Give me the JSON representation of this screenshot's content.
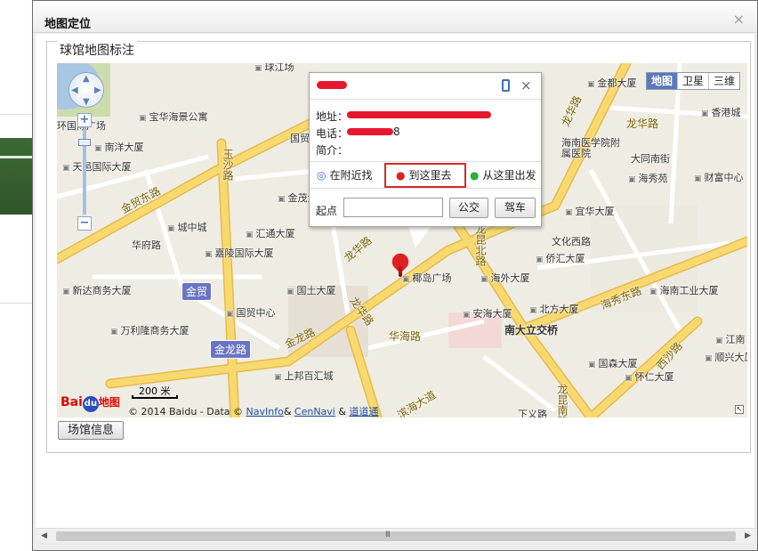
{
  "dialog": {
    "title": "地图定位",
    "close_label": "×"
  },
  "fieldset": {
    "legend": "球馆地图标注"
  },
  "map": {
    "maptype": [
      "地图",
      "卫星",
      "三维"
    ],
    "zoom_in": "+",
    "zoom_out": "−",
    "scale_text": "200 米",
    "copyright_prefix": "© 2014 Baidu - Data ©",
    "copyright_link1": "NavInfo",
    "copyright_amp1": "&",
    "copyright_link2": "CenNavi",
    "copyright_amp2": "&",
    "copyright_link3": "道道通",
    "logo_text_bai": "Bai",
    "logo_text_du": "du",
    "logo_text_map": "地图",
    "road_labels": [
      "金贸东路",
      "玉沙路",
      "金龙路",
      "龙华路",
      "龙华路",
      "龙昆北路",
      "龙昆南路",
      "海秀东路",
      "西沙路",
      "龙华路",
      "滨海大道",
      "华海路",
      "龙华路"
    ],
    "area_labels": [
      "金贸",
      "金龙路"
    ],
    "pois": [
      "宝华海景公寓",
      "南洋大厦",
      "天邑国际大厦",
      "城中城",
      "华府路",
      "嘉陵国际大厦",
      "新达商务大厦",
      "万利隆商务大厦",
      "国贸中心",
      "国土大厦",
      "汇通大厦",
      "金茂大厦",
      "上邦百汇城",
      "国贸",
      "椰岛广场",
      "海外大厦",
      "安海大厦",
      "北方大厦",
      "南大立交桥",
      "国森大厦",
      "怀仁大厦",
      "侨汇大厦",
      "文化西路",
      "宜华大厦",
      "海南工业大厦",
      "海秀苑",
      "大同南街",
      "财富中心",
      "海南医学院附属医院",
      "香港城",
      "金都大厦",
      "球江场",
      "环国际广场",
      "下义路",
      "江南",
      "顺兴大厦",
      "龙华路"
    ]
  },
  "infowin": {
    "address_label": "地址：",
    "phone_label": "电话：",
    "phone_suffix": "8",
    "intro_label": "简介：",
    "action_nearby": "在附近找",
    "action_to_here": "到这里去",
    "action_from_here": "从这里出发",
    "start_label": "起点",
    "start_input_value": "",
    "btn_bus": "公交",
    "btn_drive": "驾车",
    "close_label": "×"
  },
  "footer": {
    "venue_info_button": "场馆信息",
    "scroll_grip": "III"
  },
  "colors": {
    "highlight": "#d42b2b",
    "maptype_active": "#5a79bb",
    "redaction": "#e8162e",
    "major_road": "#f7d36b",
    "marker": "#e02020"
  }
}
